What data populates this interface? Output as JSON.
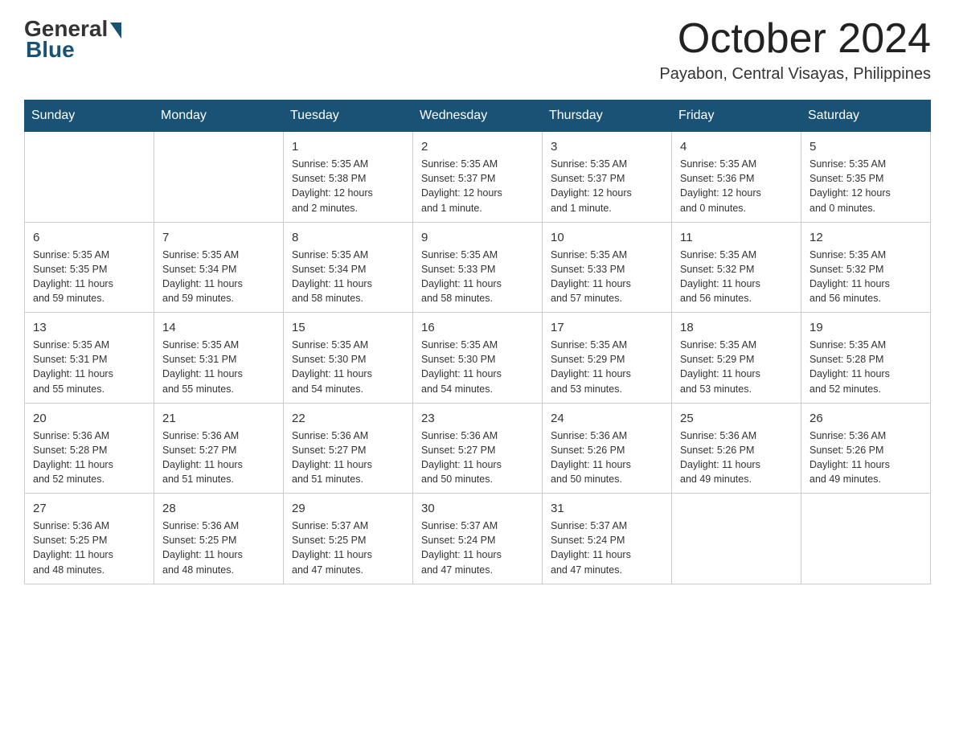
{
  "logo": {
    "general": "General",
    "blue": "Blue"
  },
  "header": {
    "month": "October 2024",
    "location": "Payabon, Central Visayas, Philippines"
  },
  "weekdays": [
    "Sunday",
    "Monday",
    "Tuesday",
    "Wednesday",
    "Thursday",
    "Friday",
    "Saturday"
  ],
  "weeks": [
    [
      {
        "day": "",
        "info": ""
      },
      {
        "day": "",
        "info": ""
      },
      {
        "day": "1",
        "info": "Sunrise: 5:35 AM\nSunset: 5:38 PM\nDaylight: 12 hours\nand 2 minutes."
      },
      {
        "day": "2",
        "info": "Sunrise: 5:35 AM\nSunset: 5:37 PM\nDaylight: 12 hours\nand 1 minute."
      },
      {
        "day": "3",
        "info": "Sunrise: 5:35 AM\nSunset: 5:37 PM\nDaylight: 12 hours\nand 1 minute."
      },
      {
        "day": "4",
        "info": "Sunrise: 5:35 AM\nSunset: 5:36 PM\nDaylight: 12 hours\nand 0 minutes."
      },
      {
        "day": "5",
        "info": "Sunrise: 5:35 AM\nSunset: 5:35 PM\nDaylight: 12 hours\nand 0 minutes."
      }
    ],
    [
      {
        "day": "6",
        "info": "Sunrise: 5:35 AM\nSunset: 5:35 PM\nDaylight: 11 hours\nand 59 minutes."
      },
      {
        "day": "7",
        "info": "Sunrise: 5:35 AM\nSunset: 5:34 PM\nDaylight: 11 hours\nand 59 minutes."
      },
      {
        "day": "8",
        "info": "Sunrise: 5:35 AM\nSunset: 5:34 PM\nDaylight: 11 hours\nand 58 minutes."
      },
      {
        "day": "9",
        "info": "Sunrise: 5:35 AM\nSunset: 5:33 PM\nDaylight: 11 hours\nand 58 minutes."
      },
      {
        "day": "10",
        "info": "Sunrise: 5:35 AM\nSunset: 5:33 PM\nDaylight: 11 hours\nand 57 minutes."
      },
      {
        "day": "11",
        "info": "Sunrise: 5:35 AM\nSunset: 5:32 PM\nDaylight: 11 hours\nand 56 minutes."
      },
      {
        "day": "12",
        "info": "Sunrise: 5:35 AM\nSunset: 5:32 PM\nDaylight: 11 hours\nand 56 minutes."
      }
    ],
    [
      {
        "day": "13",
        "info": "Sunrise: 5:35 AM\nSunset: 5:31 PM\nDaylight: 11 hours\nand 55 minutes."
      },
      {
        "day": "14",
        "info": "Sunrise: 5:35 AM\nSunset: 5:31 PM\nDaylight: 11 hours\nand 55 minutes."
      },
      {
        "day": "15",
        "info": "Sunrise: 5:35 AM\nSunset: 5:30 PM\nDaylight: 11 hours\nand 54 minutes."
      },
      {
        "day": "16",
        "info": "Sunrise: 5:35 AM\nSunset: 5:30 PM\nDaylight: 11 hours\nand 54 minutes."
      },
      {
        "day": "17",
        "info": "Sunrise: 5:35 AM\nSunset: 5:29 PM\nDaylight: 11 hours\nand 53 minutes."
      },
      {
        "day": "18",
        "info": "Sunrise: 5:35 AM\nSunset: 5:29 PM\nDaylight: 11 hours\nand 53 minutes."
      },
      {
        "day": "19",
        "info": "Sunrise: 5:35 AM\nSunset: 5:28 PM\nDaylight: 11 hours\nand 52 minutes."
      }
    ],
    [
      {
        "day": "20",
        "info": "Sunrise: 5:36 AM\nSunset: 5:28 PM\nDaylight: 11 hours\nand 52 minutes."
      },
      {
        "day": "21",
        "info": "Sunrise: 5:36 AM\nSunset: 5:27 PM\nDaylight: 11 hours\nand 51 minutes."
      },
      {
        "day": "22",
        "info": "Sunrise: 5:36 AM\nSunset: 5:27 PM\nDaylight: 11 hours\nand 51 minutes."
      },
      {
        "day": "23",
        "info": "Sunrise: 5:36 AM\nSunset: 5:27 PM\nDaylight: 11 hours\nand 50 minutes."
      },
      {
        "day": "24",
        "info": "Sunrise: 5:36 AM\nSunset: 5:26 PM\nDaylight: 11 hours\nand 50 minutes."
      },
      {
        "day": "25",
        "info": "Sunrise: 5:36 AM\nSunset: 5:26 PM\nDaylight: 11 hours\nand 49 minutes."
      },
      {
        "day": "26",
        "info": "Sunrise: 5:36 AM\nSunset: 5:26 PM\nDaylight: 11 hours\nand 49 minutes."
      }
    ],
    [
      {
        "day": "27",
        "info": "Sunrise: 5:36 AM\nSunset: 5:25 PM\nDaylight: 11 hours\nand 48 minutes."
      },
      {
        "day": "28",
        "info": "Sunrise: 5:36 AM\nSunset: 5:25 PM\nDaylight: 11 hours\nand 48 minutes."
      },
      {
        "day": "29",
        "info": "Sunrise: 5:37 AM\nSunset: 5:25 PM\nDaylight: 11 hours\nand 47 minutes."
      },
      {
        "day": "30",
        "info": "Sunrise: 5:37 AM\nSunset: 5:24 PM\nDaylight: 11 hours\nand 47 minutes."
      },
      {
        "day": "31",
        "info": "Sunrise: 5:37 AM\nSunset: 5:24 PM\nDaylight: 11 hours\nand 47 minutes."
      },
      {
        "day": "",
        "info": ""
      },
      {
        "day": "",
        "info": ""
      }
    ]
  ]
}
